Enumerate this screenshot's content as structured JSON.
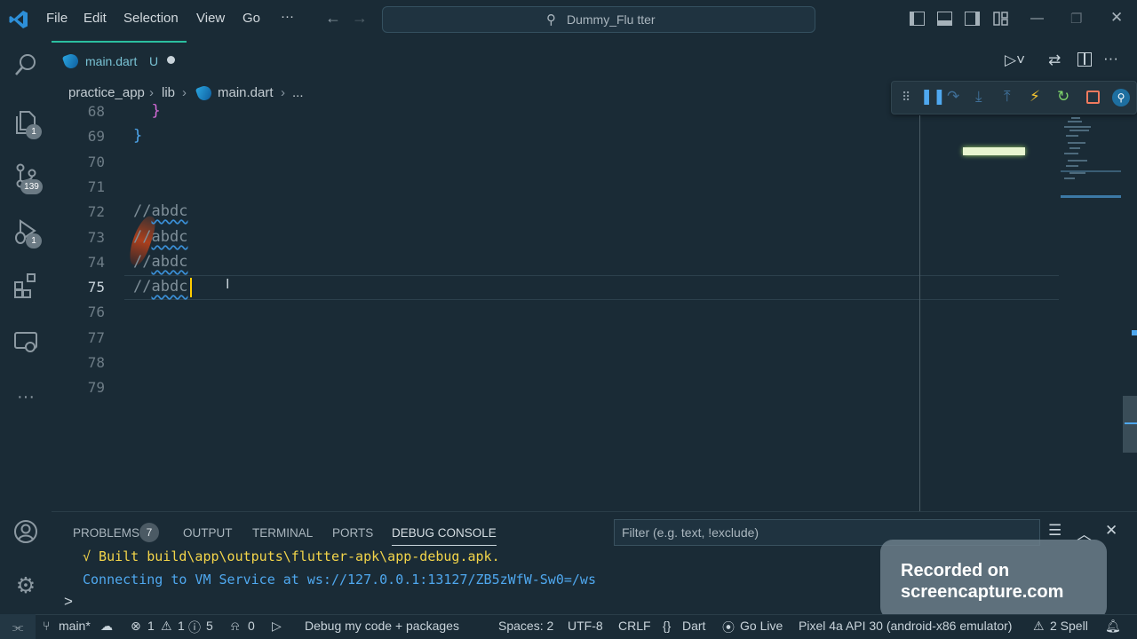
{
  "menu": [
    "File",
    "Edit",
    "Selection",
    "View",
    "Go",
    "···"
  ],
  "search_title": "Dummy_Flu tter",
  "activity_badges": {
    "explorer": "1",
    "source_control": "139",
    "run_debug": "1"
  },
  "tab": {
    "name": "main.dart",
    "status": "U"
  },
  "breadcrumb": [
    "practice_app",
    "lib",
    "main.dart",
    "..."
  ],
  "editor": {
    "lines": [
      {
        "no": "68",
        "text": "  }",
        "color": "#d36ad6"
      },
      {
        "no": "69",
        "text": "}",
        "color": "#4fa8ef"
      },
      {
        "no": "70",
        "text": ""
      },
      {
        "no": "71",
        "text": ""
      },
      {
        "no": "72",
        "prefix": "//",
        "text": "abdc"
      },
      {
        "no": "73",
        "prefix": "//",
        "text": "abdc"
      },
      {
        "no": "74",
        "prefix": "//",
        "text": "abdc"
      },
      {
        "no": "75",
        "prefix": "//",
        "text": "abdc",
        "current": true
      },
      {
        "no": "76",
        "text": ""
      },
      {
        "no": "77",
        "text": ""
      },
      {
        "no": "78",
        "text": ""
      },
      {
        "no": "79",
        "text": ""
      }
    ]
  },
  "panel": {
    "tabs": [
      "PROBLEMS",
      "OUTPUT",
      "TERMINAL",
      "PORTS",
      "DEBUG CONSOLE"
    ],
    "problems_count": "7",
    "filter_placeholder": "Filter (e.g. text, !exclude)",
    "console": [
      {
        "text": "√  Built build\\app\\outputs\\flutter-apk\\app-debug.apk.",
        "color": "#f2d44a"
      },
      {
        "text": "Connecting to VM Service at ws://127.0.0.1:13127/ZB5zWfW-Sw0=/ws",
        "color": "#4fa8ef"
      }
    ],
    "prompt": ">"
  },
  "watermark": {
    "line1": "Recorded on",
    "line2": "screencapture.com"
  },
  "statusbar": {
    "branch": "main*",
    "errors": "1",
    "warnings": "1",
    "infos": "5",
    "ports": "0",
    "debug": "Debug my code + packages",
    "spaces": "Spaces: 2",
    "encoding": "UTF-8",
    "eol": "CRLF",
    "language": "Dart",
    "golive": "Go Live",
    "device": "Pixel 4a API 30 (android-x86 emulator)",
    "spell": "2 Spell"
  },
  "colors": {
    "accent": "#2bbfa0",
    "cursor": "#ffcc00",
    "background": "#1a2b36"
  }
}
